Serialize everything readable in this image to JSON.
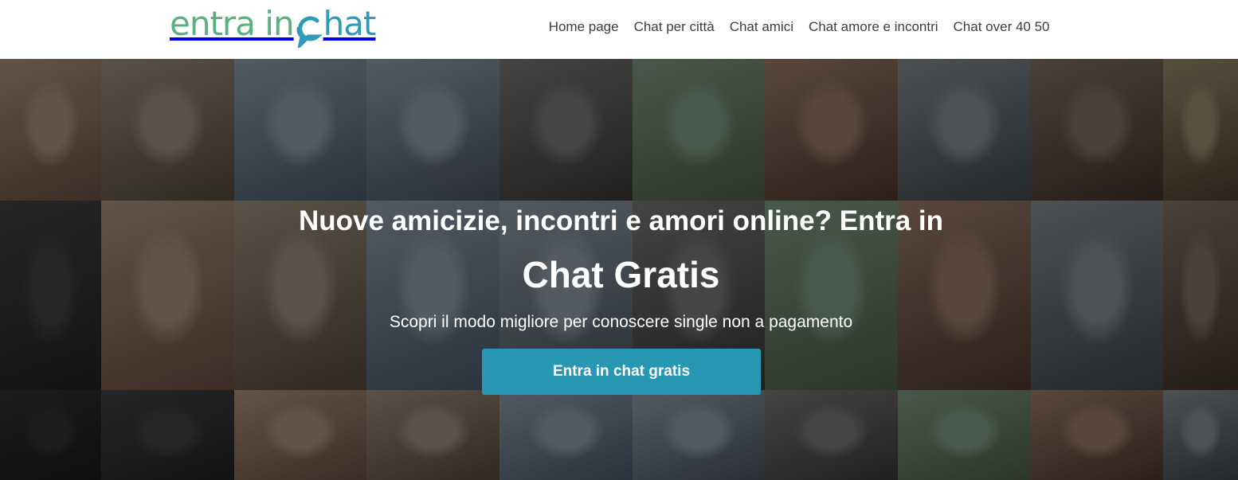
{
  "brand": {
    "logo_part1": "entra in",
    "logo_part2": "hat",
    "color_green": "#5bb17e",
    "color_blue": "#2f9bb7"
  },
  "nav": {
    "items": [
      "Home page",
      "Chat per città",
      "Chat amici",
      "Chat amore e incontri",
      "Chat over 40 50"
    ]
  },
  "hero": {
    "headline": "Nuove amicizie, incontri e amori online? Entra in",
    "title": "Chat Gratis",
    "subtitle": "Scopri il modo migliore per conoscere single non a pagamento",
    "cta_label": "Entra in chat gratis",
    "cta_color": "#2797b4",
    "background": "mosaic of profile photos with dark overlay"
  }
}
